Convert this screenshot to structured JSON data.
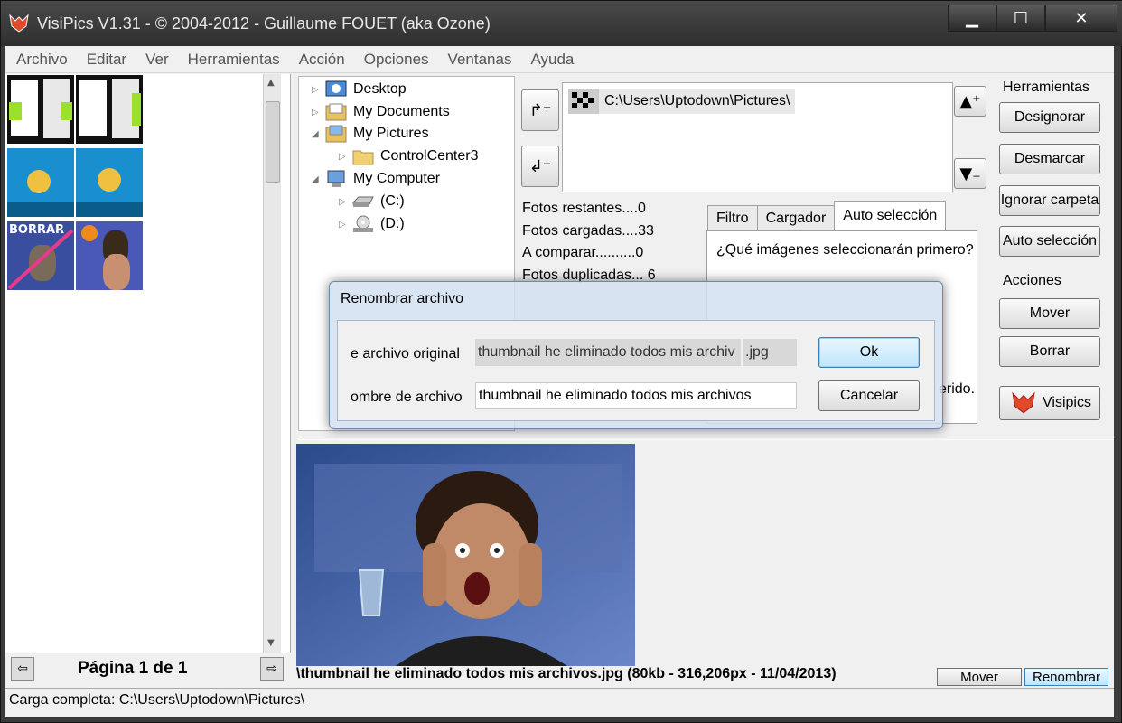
{
  "window": {
    "title": "VisiPics V1.31 - © 2004-2012 - Guillaume FOUET (aka Ozone)"
  },
  "menu": [
    "Archivo",
    "Editar",
    "Ver",
    "Herramientas",
    "Acción",
    "Opciones",
    "Ventanas",
    "Ayuda"
  ],
  "thumbs": {
    "borrar_label": "BORRAR"
  },
  "pager": {
    "label": "Página 1 de 1"
  },
  "tree": {
    "items": [
      {
        "label": "Desktop"
      },
      {
        "label": "My Documents"
      },
      {
        "label": "My Pictures"
      },
      {
        "label": "ControlCenter3"
      },
      {
        "label": "My Computer"
      },
      {
        "label": "(C:)"
      },
      {
        "label": "(D:)"
      }
    ]
  },
  "folders": {
    "entry": "C:\\Users\\Uptodown\\Pictures\\"
  },
  "stats": [
    "Fotos restantes....0",
    "Fotos cargadas....33",
    "A comparar..........0",
    "Fotos duplicadas... 6"
  ],
  "tabs": [
    {
      "label": "Filtro"
    },
    {
      "label": "Cargador"
    },
    {
      "label": "Auto selección"
    }
  ],
  "tab_panel": {
    "question": "¿Qué imágenes seleccionarán primero?",
    "trailing_text": "erido."
  },
  "tools": {
    "herramientas_label": "Herramientas",
    "designorar": "Designorar",
    "desmarcar": "Desmarcar",
    "ignorar_carpeta": "Ignorar carpeta",
    "auto_seleccion": "Auto selección",
    "acciones_label": "Acciones",
    "mover": "Mover",
    "borrar": "Borrar",
    "visipics": "Visipics"
  },
  "preview": {
    "caption": "\\thumbnail he eliminado todos mis archivos.jpg (80kb - 316,206px - 11/04/2013)",
    "mover": "Mover",
    "renombrar": "Renombrar"
  },
  "status": {
    "text": "Carga completa: C:\\Users\\Uptodown\\Pictures\\"
  },
  "dialog": {
    "title": "Renombrar archivo",
    "original_label": "e archivo original",
    "original_name": "thumbnail he eliminado todos mis archiv",
    "original_ext": ".jpg",
    "new_label": "ombre de archivo",
    "new_name": "thumbnail he eliminado todos mis archivos",
    "ok": "Ok",
    "cancel": "Cancelar"
  },
  "colors": {
    "accent": "#3c7fb1",
    "window_frame": "#3b3b3b"
  }
}
